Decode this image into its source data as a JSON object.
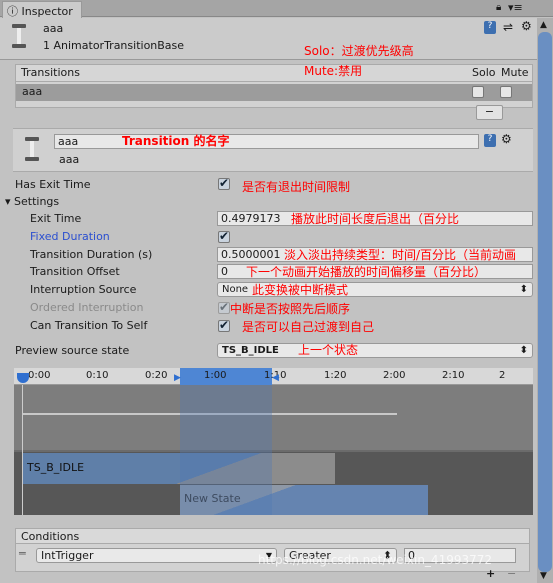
{
  "tab": {
    "title": "Inspector",
    "icon": "info-icon"
  },
  "header": {
    "name": "aaa",
    "subtitle": "1 AnimatorTransitionBase"
  },
  "transitions": {
    "header": "Transitions",
    "solo": "Solo",
    "mute": "Mute",
    "rows": [
      {
        "name": "aaa",
        "solo": false,
        "mute": false
      }
    ],
    "remove_label": "−"
  },
  "transition": {
    "name_value": "aaa",
    "subname": "aaa"
  },
  "settings": {
    "has_exit_time": {
      "label": "Has Exit Time",
      "checked": true
    },
    "section_label": "Settings",
    "exit_time": {
      "label": "Exit Time",
      "value": "0.4979173"
    },
    "fixed_duration": {
      "label": "Fixed Duration",
      "checked": true
    },
    "transition_duration": {
      "label": "Transition Duration (s)",
      "value": "0.5000001"
    },
    "transition_offset": {
      "label": "Transition Offset",
      "value": "0"
    },
    "interruption_source": {
      "label": "Interruption Source",
      "value": "None"
    },
    "ordered_interruption": {
      "label": "Ordered Interruption",
      "checked": true
    },
    "can_transition_to_self": {
      "label": "Can Transition To Self",
      "checked": true
    },
    "preview_source_state": {
      "label": "Preview source state",
      "value": "TS_B_IDLE"
    }
  },
  "annotations": {
    "solo": "Solo：过渡优先级高",
    "mute": "Mute:禁用",
    "name": "Transition 的名字",
    "has_exit": "是否有退出时间限制",
    "exit_time": "播放此时间长度后退出（百分比",
    "duration": "淡入淡出持续类型：时间/百分比（当前动画",
    "offset": "下一个动画开始播放的时间偏移量（百分比）",
    "interruption": "此变换被中断模式",
    "ordered": "中断是否按照先后顺序",
    "self": "是否可以自己过渡到自己",
    "preview": "上一个状态"
  },
  "timeline": {
    "ticks": [
      "0:00",
      "0:10",
      "0:20",
      "1:00",
      "1:10",
      "1:20",
      "2:00",
      "2:10",
      "2"
    ],
    "source_state": "TS_B_IDLE",
    "dest_state": "New State"
  },
  "conditions": {
    "header": "Conditions",
    "parameter": "IntTrigger",
    "mode": "Greater",
    "value": "0",
    "add_label": "+",
    "remove_label": "−"
  },
  "watermark": "https://blog.csdn.net/weixin_41993772",
  "colors": {
    "accent": "#4a7fc8",
    "annotation": "#ff0000",
    "fixed_duration_label": "#2b4fd0"
  }
}
